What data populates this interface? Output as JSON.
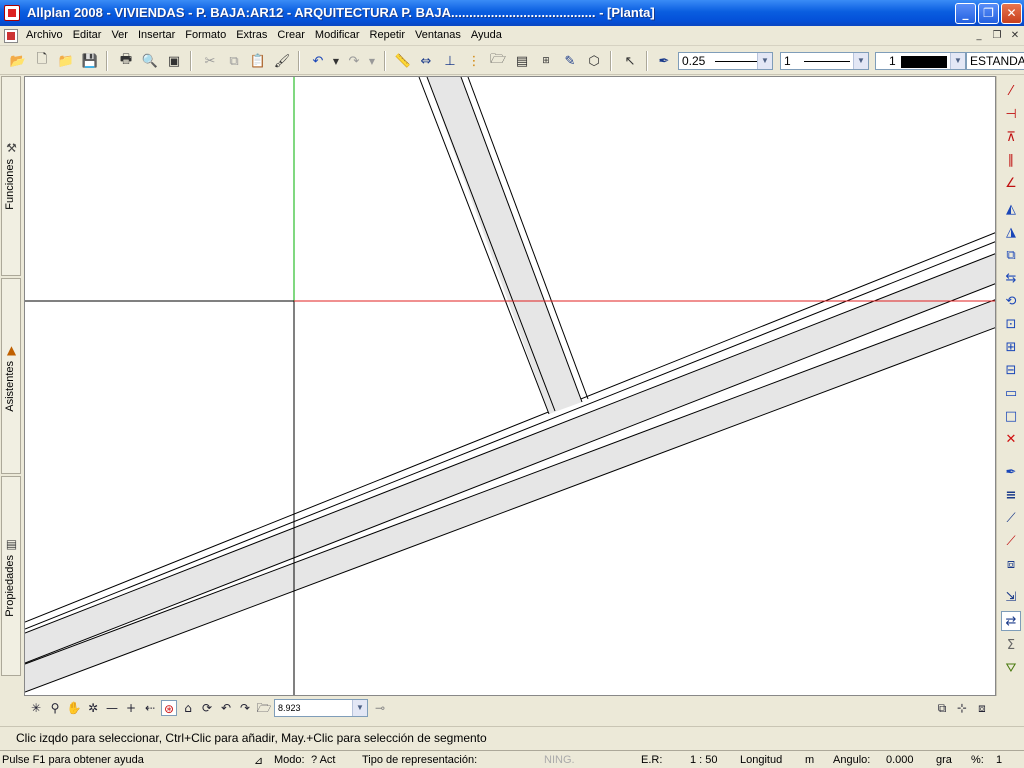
{
  "window": {
    "title": "Allplan 2008 - VIVIENDAS - P. BAJA:AR12 - ARQUITECTURA P. BAJA........................................ - [Planta]",
    "minimize": "_",
    "maximize": "❐",
    "close": "✕"
  },
  "menu": {
    "items": [
      "Archivo",
      "Editar",
      "Ver",
      "Insertar",
      "Formato",
      "Extras",
      "Crear",
      "Modificar",
      "Repetir",
      "Ventanas",
      "Ayuda"
    ],
    "mdi_min": "_",
    "mdi_restore": "❐",
    "mdi_close": "✕"
  },
  "toolbar": {
    "pen_value": "0.25",
    "line_value": "1",
    "color_value": "1",
    "style_value": "ESTANDA"
  },
  "left_dock": {
    "tabs": [
      "Funciones",
      "Asistentes",
      "Propiedades"
    ]
  },
  "view_bar": {
    "zoom_value": "8.923"
  },
  "hint": "Clic izqdo para seleccionar, Ctrl+Clic para añadir, May.+Clic para selección de segmento",
  "status": {
    "help": "Pulse F1 para obtener ayuda",
    "modo_label": "Modo:",
    "modo_value": "? Act",
    "repr_label": "Tipo de representación:",
    "ning": "NING.",
    "er_label": "E.R:",
    "er_value": "1 : 50",
    "longitud_label": "Longitud",
    "longitud_unit": "m",
    "angulo_label": "Angulo:",
    "angulo_value": "0.000",
    "angulo_unit": "gra",
    "pct_label": "%:",
    "pct_value": "1"
  },
  "colors": {
    "titlebar": "#0a5ee0",
    "crosshair_h": "#e02020",
    "crosshair_v": "#00b000",
    "wall_fill": "#e6e6e6",
    "delete_red": "#d01010"
  },
  "icons": {
    "right_toolbar": [
      "draw-line-icon",
      "draw-offset-icon",
      "draw-polyline-icon",
      "parallel-lines-icon",
      "angle-icon",
      "mirror-icon",
      "mirror-copy-icon",
      "copy-icon",
      "move-icon",
      "rotate-icon",
      "scale-icon",
      "stretch-icon",
      "modify-icon",
      "dimension-icon",
      "element-icon",
      "delete-icon",
      "pipette-icon",
      "line-thickness-icon",
      "line-type-icon",
      "pen-color-icon",
      "layer-icon",
      "select-icon",
      "properties-icon",
      "sum-icon",
      "filter-icon"
    ]
  }
}
